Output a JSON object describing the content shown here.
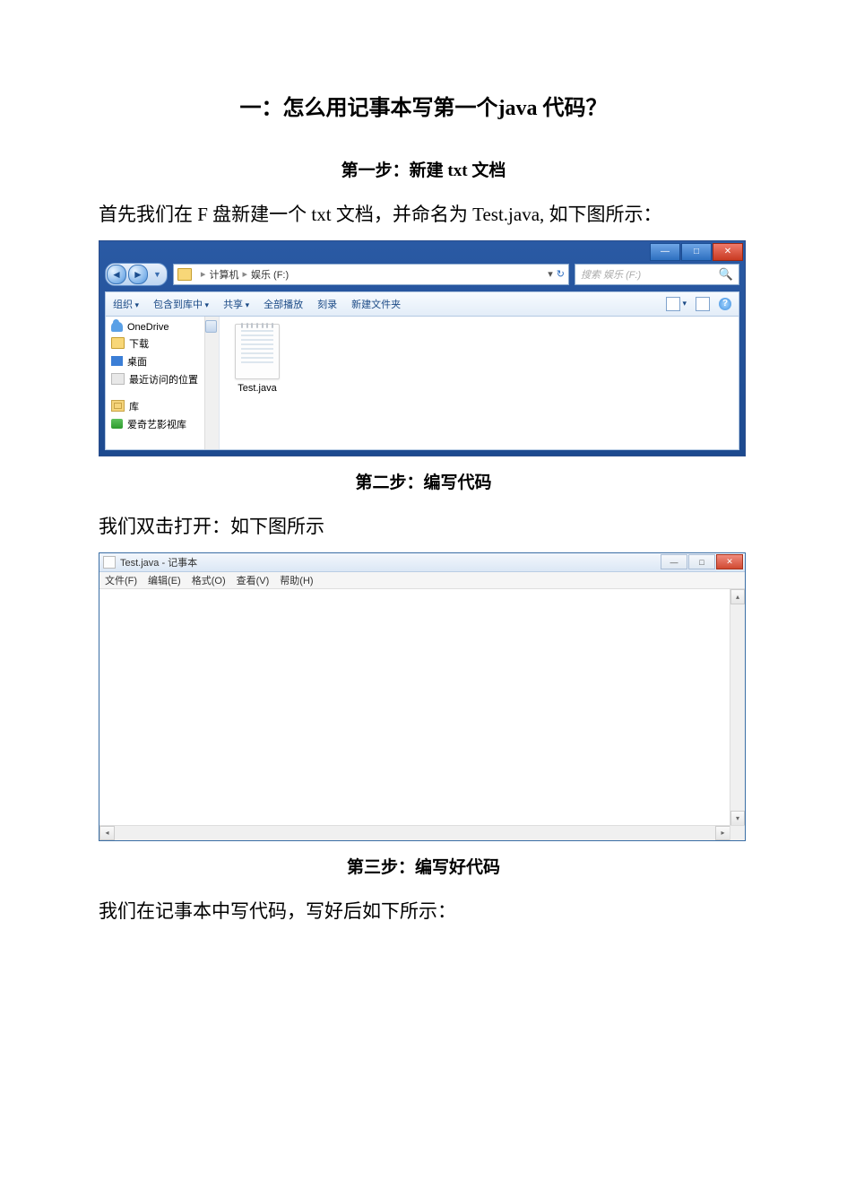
{
  "title": "一：怎么用记事本写第一个java 代码？",
  "step1": {
    "heading": "第一步：新建 txt 文档",
    "paragraph": "首先我们在 F 盘新建一个 txt 文档，并命名为 Test.java, 如下图所示："
  },
  "explorer": {
    "breadcrumb": {
      "seg1": "计算机",
      "seg2": "娱乐 (F:)"
    },
    "search_placeholder": "搜索 娱乐 (F:)",
    "toolbar": {
      "organize": "组织",
      "include": "包含到库中",
      "share": "共享",
      "burn": "全部播放",
      "slideshow": "刻录",
      "newfolder": "新建文件夹"
    },
    "sidebar": {
      "onedrive": "OneDrive",
      "downloads": "下载",
      "desktop": "桌面",
      "recent": "最近访问的位置",
      "libraries": "库",
      "iqiyi": "爱奇艺影视库"
    },
    "file_name": "Test.java"
  },
  "step2": {
    "heading": "第二步：编写代码",
    "paragraph": "我们双击打开：如下图所示"
  },
  "notepad": {
    "title": "Test.java - 记事本",
    "menu": {
      "file": "文件(F)",
      "edit": "编辑(E)",
      "format": "格式(O)",
      "view": "查看(V)",
      "help": "帮助(H)"
    }
  },
  "step3": {
    "heading": "第三步：编写好代码",
    "paragraph": "我们在记事本中写代码，写好后如下所示："
  }
}
